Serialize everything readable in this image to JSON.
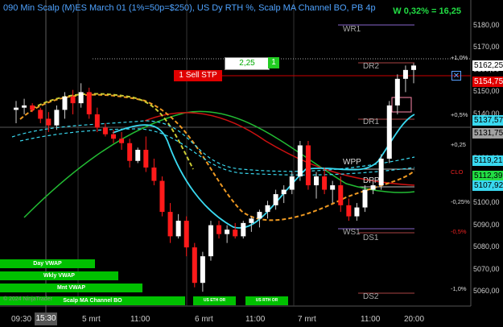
{
  "title": "090 Min Scalp (M)ES March 01 (1%=50p=$250), US Dy RTH %, Scalp MA Channel BO, PB 4p",
  "pnl": "W 0,32% = 16,25",
  "price_axis": [
    "5180,00",
    "5170,00",
    "5160,00",
    "5150,00",
    "5140,00",
    "5130,00",
    "5120,00",
    "5110,00",
    "5100,00",
    "5090,00",
    "5080,00",
    "5070,00",
    "5060,00"
  ],
  "price_boxes": [
    {
      "label": "5162,25",
      "bg": "#ffffff",
      "fg": "#000000"
    },
    {
      "label": "5154,75",
      "bg": "#e00000",
      "fg": "#ffffff"
    },
    {
      "label": "5137,57",
      "bg": "#39d9f0",
      "fg": "#000000"
    },
    {
      "label": "5131,75",
      "bg": "#a0a0a0",
      "fg": "#000000"
    },
    {
      "label": "5119,21",
      "bg": "#39d9f0",
      "fg": "#000000"
    },
    {
      "label": "5112,39",
      "bg": "#22dd44",
      "fg": "#000000"
    },
    {
      "label": "5107,92",
      "bg": "#39d9f0",
      "fg": "#000000"
    }
  ],
  "levels": [
    "WR1",
    "DR2",
    "DR1",
    "WPP",
    "DPP",
    "WS1",
    "DS1",
    "DS2"
  ],
  "pct_labels": [
    "+1,0%",
    "+0,5%",
    "+0,25",
    "CLO",
    "-0,25%",
    "-0,5%",
    "-1,0%"
  ],
  "order": {
    "qty": "2,25",
    "qty_btn": "1",
    "stop_label": "1 Sell STP",
    "close_icon": "x-icon"
  },
  "vwap_bars": [
    "Day VWAP",
    "Wkly VWAP",
    "Mnt VWAP"
  ],
  "strategy_bar": "Scalp MA Channel BO",
  "small_bars": [
    "US ETH OR",
    "US RTH OR"
  ],
  "copyright": "© 2024 NinjaTrader",
  "x_axis": {
    "highlight": "15:30",
    "labels": [
      "09:30",
      "5 mrt",
      "11:00",
      "6 mrt",
      "11:00",
      "7 mrt",
      "11:00",
      "20:00"
    ]
  },
  "chart_data": {
    "type": "candlestick",
    "ylim": [
      5055,
      5185
    ],
    "candles": [
      {
        "o": 5142,
        "h": 5146,
        "l": 5136,
        "c": 5143
      },
      {
        "o": 5143,
        "h": 5147,
        "l": 5140,
        "c": 5144
      },
      {
        "o": 5144,
        "h": 5145,
        "l": 5141,
        "c": 5142
      },
      {
        "o": 5142,
        "h": 5143,
        "l": 5136,
        "c": 5138
      },
      {
        "o": 5138,
        "h": 5141,
        "l": 5132,
        "c": 5135
      },
      {
        "o": 5135,
        "h": 5144,
        "l": 5133,
        "c": 5142
      },
      {
        "o": 5142,
        "h": 5150,
        "l": 5138,
        "c": 5148
      },
      {
        "o": 5148,
        "h": 5151,
        "l": 5140,
        "c": 5145
      },
      {
        "o": 5145,
        "h": 5154,
        "l": 5143,
        "c": 5150
      },
      {
        "o": 5150,
        "h": 5152,
        "l": 5138,
        "c": 5140
      },
      {
        "o": 5140,
        "h": 5143,
        "l": 5132,
        "c": 5134
      },
      {
        "o": 5134,
        "h": 5136,
        "l": 5130,
        "c": 5131
      },
      {
        "o": 5131,
        "h": 5133,
        "l": 5127,
        "c": 5129
      },
      {
        "o": 5129,
        "h": 5132,
        "l": 5124,
        "c": 5127
      },
      {
        "o": 5127,
        "h": 5129,
        "l": 5116,
        "c": 5119
      },
      {
        "o": 5119,
        "h": 5125,
        "l": 5118,
        "c": 5124
      },
      {
        "o": 5124,
        "h": 5130,
        "l": 5114,
        "c": 5116
      },
      {
        "o": 5116,
        "h": 5120,
        "l": 5108,
        "c": 5110
      },
      {
        "o": 5110,
        "h": 5112,
        "l": 5094,
        "c": 5096
      },
      {
        "o": 5096,
        "h": 5100,
        "l": 5082,
        "c": 5085
      },
      {
        "o": 5085,
        "h": 5095,
        "l": 5084,
        "c": 5092
      },
      {
        "o": 5092,
        "h": 5094,
        "l": 5076,
        "c": 5080
      },
      {
        "o": 5080,
        "h": 5082,
        "l": 5062,
        "c": 5064
      },
      {
        "o": 5064,
        "h": 5078,
        "l": 5060,
        "c": 5076
      },
      {
        "o": 5076,
        "h": 5092,
        "l": 5074,
        "c": 5090
      },
      {
        "o": 5090,
        "h": 5092,
        "l": 5084,
        "c": 5086
      },
      {
        "o": 5086,
        "h": 5090,
        "l": 5082,
        "c": 5088
      },
      {
        "o": 5088,
        "h": 5091,
        "l": 5084,
        "c": 5085
      },
      {
        "o": 5085,
        "h": 5092,
        "l": 5084,
        "c": 5091
      },
      {
        "o": 5091,
        "h": 5094,
        "l": 5087,
        "c": 5093
      },
      {
        "o": 5093,
        "h": 5097,
        "l": 5089,
        "c": 5096
      },
      {
        "o": 5096,
        "h": 5101,
        "l": 5093,
        "c": 5099
      },
      {
        "o": 5099,
        "h": 5106,
        "l": 5097,
        "c": 5104
      },
      {
        "o": 5104,
        "h": 5108,
        "l": 5100,
        "c": 5106
      },
      {
        "o": 5106,
        "h": 5114,
        "l": 5104,
        "c": 5112
      },
      {
        "o": 5112,
        "h": 5128,
        "l": 5110,
        "c": 5126
      },
      {
        "o": 5126,
        "h": 5128,
        "l": 5106,
        "c": 5108
      },
      {
        "o": 5108,
        "h": 5114,
        "l": 5102,
        "c": 5112
      },
      {
        "o": 5112,
        "h": 5116,
        "l": 5104,
        "c": 5106
      },
      {
        "o": 5106,
        "h": 5110,
        "l": 5100,
        "c": 5108
      },
      {
        "o": 5108,
        "h": 5112,
        "l": 5096,
        "c": 5099
      },
      {
        "o": 5099,
        "h": 5102,
        "l": 5092,
        "c": 5094
      },
      {
        "o": 5094,
        "h": 5100,
        "l": 5092,
        "c": 5098
      },
      {
        "o": 5098,
        "h": 5108,
        "l": 5096,
        "c": 5106
      },
      {
        "o": 5106,
        "h": 5110,
        "l": 5104,
        "c": 5108
      },
      {
        "o": 5108,
        "h": 5122,
        "l": 5106,
        "c": 5120
      },
      {
        "o": 5120,
        "h": 5146,
        "l": 5118,
        "c": 5144
      },
      {
        "o": 5144,
        "h": 5158,
        "l": 5140,
        "c": 5156
      },
      {
        "o": 5156,
        "h": 5162,
        "l": 5150,
        "c": 5160
      },
      {
        "o": 5160,
        "h": 5163,
        "l": 5154,
        "c": 5162
      }
    ]
  }
}
